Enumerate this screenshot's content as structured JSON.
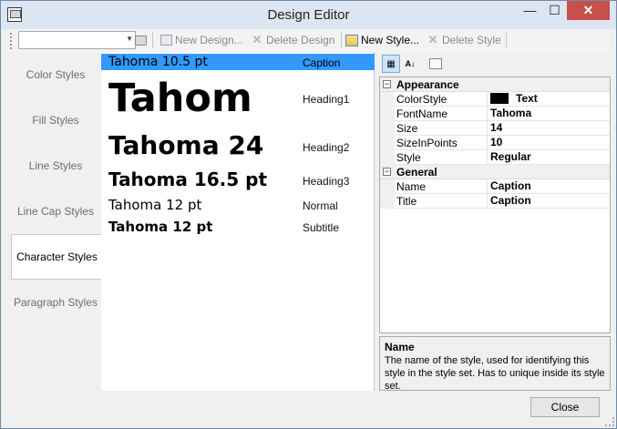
{
  "window": {
    "title": "Design Editor",
    "close_glyph": "✕",
    "min_glyph": "—",
    "max_glyph": "☐"
  },
  "toolbar": {
    "design_select_value": "",
    "new_design_label": "New Design...",
    "delete_design_label": "Delete Design",
    "new_style_label": "New Style...",
    "delete_style_label": "Delete Style"
  },
  "tabs": [
    {
      "label": "Color Styles"
    },
    {
      "label": "Fill Styles"
    },
    {
      "label": "Line Styles"
    },
    {
      "label": "Line Cap Styles"
    },
    {
      "label": "Character Styles"
    },
    {
      "label": "Paragraph Styles"
    }
  ],
  "styles": [
    {
      "sample": "Tahoma 10.5 pt",
      "kind": "Caption"
    },
    {
      "sample": "Tahom",
      "kind": "Heading1"
    },
    {
      "sample": "Tahoma 24",
      "kind": "Heading2"
    },
    {
      "sample": "Tahoma 16.5 pt",
      "kind": "Heading3"
    },
    {
      "sample": "Tahoma 12 pt",
      "kind": "Normal"
    },
    {
      "sample": "Tahoma 12 pt",
      "kind": "Subtitle"
    }
  ],
  "properties": {
    "categories": [
      {
        "name": "Appearance",
        "toggle": "−",
        "items": [
          {
            "name": "ColorStyle",
            "value": "Text"
          },
          {
            "name": "FontName",
            "value": "Tahoma"
          },
          {
            "name": "Size",
            "value": "14"
          },
          {
            "name": "SizeInPoints",
            "value": "10"
          },
          {
            "name": "Style",
            "value": "Regular"
          }
        ]
      },
      {
        "name": "General",
        "toggle": "−",
        "items": [
          {
            "name": "Name",
            "value": "Caption"
          },
          {
            "name": "Title",
            "value": "Caption"
          }
        ]
      }
    ],
    "description": {
      "title": "Name",
      "text": "The name of the style, used for identifying this style in the style set. Has to unique inside its style set."
    }
  },
  "footer": {
    "close_label": "Close"
  },
  "colors": {
    "selection": "#3399ff",
    "close_red": "#c7504b",
    "swatch": "#000000"
  }
}
